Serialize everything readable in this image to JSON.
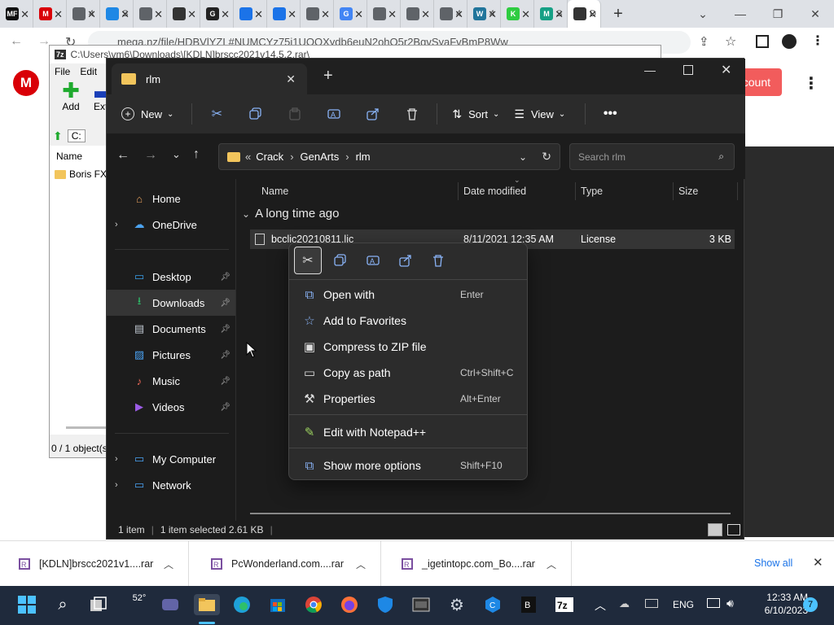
{
  "chrome": {
    "tabs": [
      {
        "icon": "mf-favicon",
        "text": "",
        "color": "#111111",
        "glyph": "MF"
      },
      {
        "icon": "mega-favicon",
        "text": "",
        "color": "#d90007",
        "glyph": "M"
      },
      {
        "icon": "globe-favicon",
        "text": "4",
        "color": "#5f6368",
        "glyph": ""
      },
      {
        "icon": "edge-favicon",
        "text": "S",
        "color": "#1e88e5",
        "glyph": ""
      },
      {
        "icon": "chrome-favicon",
        "text": "",
        "color": "#5f6368",
        "glyph": ""
      },
      {
        "icon": "download-favicon",
        "text": "",
        "color": "#333333",
        "glyph": ""
      },
      {
        "icon": "g-favicon",
        "text": "",
        "color": "#222222",
        "glyph": "G"
      },
      {
        "icon": "shield-favicon",
        "text": "",
        "color": "#1b73e8",
        "glyph": ""
      },
      {
        "icon": "shield-favicon",
        "text": "",
        "color": "#1b73e8",
        "glyph": ""
      },
      {
        "icon": "globe-favicon",
        "text": "",
        "color": "#5f6368",
        "glyph": ""
      },
      {
        "icon": "google-favicon",
        "text": "",
        "color": "#4285f4",
        "glyph": "G"
      },
      {
        "icon": "globe-favicon",
        "text": "",
        "color": "#5f6368",
        "glyph": ""
      },
      {
        "icon": "globe-favicon",
        "text": "",
        "color": "#5f6368",
        "glyph": ""
      },
      {
        "icon": "globe-favicon",
        "text": "4",
        "color": "#5f6368",
        "glyph": ""
      },
      {
        "icon": "wordpress-favicon",
        "text": "4",
        "color": "#21759b",
        "glyph": "W"
      },
      {
        "icon": "k-favicon",
        "text": "",
        "color": "#2ecc40",
        "glyph": "K"
      },
      {
        "icon": "m-favicon",
        "text": "S",
        "color": "#16a085",
        "glyph": "M"
      },
      {
        "icon": "d-favicon",
        "text": "D",
        "color": "#333333",
        "glyph": ""
      }
    ],
    "address": "mega.nz/file/HDBVlYZL#NUMCYz75i1UOQXydb6euN2ohO5r2BgvSyaFvBmP8Ww",
    "mega_button": "count"
  },
  "sevenzip": {
    "title": "C:\\Users\\vm6\\Downloads\\[KDLN]brscc2021v14.5.2.rar\\",
    "menu": [
      "File",
      "Edit"
    ],
    "tools": [
      "Add",
      "Extra"
    ],
    "path_short": "C:",
    "column_name": "Name",
    "folder_item": "Boris FX",
    "status": "0 / 1 object(s"
  },
  "explorer": {
    "tab_title": "rlm",
    "toolbar": {
      "new": "New",
      "sort": "Sort",
      "view": "View"
    },
    "breadcrumb": [
      "Crack",
      "GenArts",
      "rlm"
    ],
    "breadcrumb_prefix": "«",
    "search_placeholder": "Search rlm",
    "sidebar": [
      {
        "label": "Home",
        "icon": "home-icon",
        "chevron": false,
        "pinned": false
      },
      {
        "label": "OneDrive",
        "icon": "cloud-icon",
        "chevron": true,
        "pinned": false
      },
      {
        "label": "Desktop",
        "icon": "desktop-icon",
        "chevron": false,
        "pinned": true
      },
      {
        "label": "Downloads",
        "icon": "download-icon",
        "chevron": false,
        "pinned": true
      },
      {
        "label": "Documents",
        "icon": "document-icon",
        "chevron": false,
        "pinned": true
      },
      {
        "label": "Pictures",
        "icon": "picture-icon",
        "chevron": false,
        "pinned": true
      },
      {
        "label": "Music",
        "icon": "music-icon",
        "chevron": false,
        "pinned": true
      },
      {
        "label": "Videos",
        "icon": "video-icon",
        "chevron": false,
        "pinned": true
      },
      {
        "label": "My Computer",
        "icon": "computer-icon",
        "chevron": true,
        "pinned": false
      },
      {
        "label": "Network",
        "icon": "network-icon",
        "chevron": true,
        "pinned": false
      }
    ],
    "columns": [
      "Name",
      "Date modified",
      "Type",
      "Size"
    ],
    "group": "A long time ago",
    "file": {
      "name": "bcclic20210811.lic",
      "date": "8/11/2021 12:35 AM",
      "type": "License",
      "size": "3 KB"
    },
    "status": {
      "count": "1 item",
      "selected": "1 item selected  2.61 KB"
    }
  },
  "context_menu": {
    "items": [
      {
        "label": "Open with",
        "shortcut": "Enter",
        "icon": "open-with-icon"
      },
      {
        "label": "Add to Favorites",
        "shortcut": "",
        "icon": "star-icon"
      },
      {
        "label": "Compress to ZIP file",
        "shortcut": "",
        "icon": "zip-icon"
      },
      {
        "label": "Copy as path",
        "shortcut": "Ctrl+Shift+C",
        "icon": "copy-path-icon"
      },
      {
        "label": "Properties",
        "shortcut": "Alt+Enter",
        "icon": "wrench-icon"
      },
      {
        "label": "Edit with Notepad++",
        "shortcut": "",
        "icon": "notepad-icon"
      },
      {
        "label": "Show more options",
        "shortcut": "Shift+F10",
        "icon": "more-options-icon"
      }
    ]
  },
  "downloads": {
    "items": [
      "[KDLN]brscc2021v1....rar",
      "PcWonderland.com....rar",
      "_igetintopc.com_Bo....rar"
    ],
    "show_all": "Show all"
  },
  "taskbar": {
    "weather": "52°",
    "lang": "ENG",
    "time": "12:33 AM",
    "date": "6/10/2023",
    "notifications": "7"
  },
  "colors": {
    "accent_red": "#f25c5c",
    "mega_red": "#d90007",
    "explorer_bg": "#1c1c1c",
    "taskbar_bg": "#1f2a3c"
  }
}
